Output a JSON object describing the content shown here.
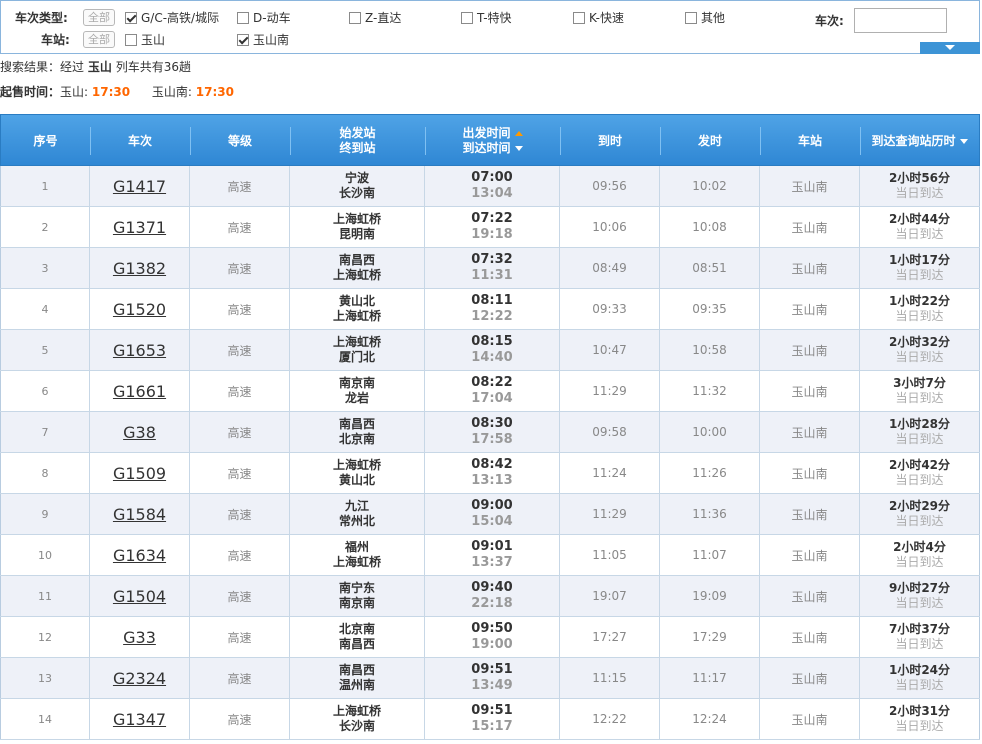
{
  "filters": {
    "type_label": "车次类型:",
    "all_label": "全部",
    "types": [
      {
        "label": "G/C-高铁/城际",
        "checked": true
      },
      {
        "label": "D-动车",
        "checked": false
      },
      {
        "label": "Z-直达",
        "checked": false
      },
      {
        "label": "T-特快",
        "checked": false
      },
      {
        "label": "K-快速",
        "checked": false
      },
      {
        "label": "其他",
        "checked": false
      }
    ],
    "station_label": "车站:",
    "stations": [
      {
        "label": "玉山",
        "checked": false
      },
      {
        "label": "玉山南",
        "checked": true
      }
    ],
    "train_no_label": "车次:",
    "train_no_value": ""
  },
  "summary": {
    "prefix": "搜索结果：经过",
    "station": "玉山",
    "suffix": "列车共有36趟",
    "sale_label": "起售时间：",
    "sale1_station": "玉山:",
    "sale1_time": "17:30",
    "sale2_station": "玉山南:",
    "sale2_time": "17:30"
  },
  "table": {
    "headers": {
      "idx": "序号",
      "train": "车次",
      "grade": "等级",
      "from": "始发站",
      "to": "终到站",
      "dep": "出发时间",
      "arr": "到达时间",
      "arrive": "到时",
      "depart": "发时",
      "station": "车站",
      "duration": "到达查询站历时"
    },
    "rows": [
      {
        "idx": "1",
        "train": "G1417",
        "grade": "高速",
        "from": "宁波",
        "to": "长沙南",
        "dep": "07:00",
        "arr": "13:04",
        "arrive": "09:56",
        "depart": "10:02",
        "station": "玉山南",
        "dur": "2小时56分",
        "same": "当日到达"
      },
      {
        "idx": "2",
        "train": "G1371",
        "grade": "高速",
        "from": "上海虹桥",
        "to": "昆明南",
        "dep": "07:22",
        "arr": "19:18",
        "arrive": "10:06",
        "depart": "10:08",
        "station": "玉山南",
        "dur": "2小时44分",
        "same": "当日到达"
      },
      {
        "idx": "3",
        "train": "G1382",
        "grade": "高速",
        "from": "南昌西",
        "to": "上海虹桥",
        "dep": "07:32",
        "arr": "11:31",
        "arrive": "08:49",
        "depart": "08:51",
        "station": "玉山南",
        "dur": "1小时17分",
        "same": "当日到达"
      },
      {
        "idx": "4",
        "train": "G1520",
        "grade": "高速",
        "from": "黄山北",
        "to": "上海虹桥",
        "dep": "08:11",
        "arr": "12:22",
        "arrive": "09:33",
        "depart": "09:35",
        "station": "玉山南",
        "dur": "1小时22分",
        "same": "当日到达"
      },
      {
        "idx": "5",
        "train": "G1653",
        "grade": "高速",
        "from": "上海虹桥",
        "to": "厦门北",
        "dep": "08:15",
        "arr": "14:40",
        "arrive": "10:47",
        "depart": "10:58",
        "station": "玉山南",
        "dur": "2小时32分",
        "same": "当日到达"
      },
      {
        "idx": "6",
        "train": "G1661",
        "grade": "高速",
        "from": "南京南",
        "to": "龙岩",
        "dep": "08:22",
        "arr": "17:04",
        "arrive": "11:29",
        "depart": "11:32",
        "station": "玉山南",
        "dur": "3小时7分",
        "same": "当日到达"
      },
      {
        "idx": "7",
        "train": "G38",
        "grade": "高速",
        "from": "南昌西",
        "to": "北京南",
        "dep": "08:30",
        "arr": "17:58",
        "arrive": "09:58",
        "depart": "10:00",
        "station": "玉山南",
        "dur": "1小时28分",
        "same": "当日到达"
      },
      {
        "idx": "8",
        "train": "G1509",
        "grade": "高速",
        "from": "上海虹桥",
        "to": "黄山北",
        "dep": "08:42",
        "arr": "13:13",
        "arrive": "11:24",
        "depart": "11:26",
        "station": "玉山南",
        "dur": "2小时42分",
        "same": "当日到达"
      },
      {
        "idx": "9",
        "train": "G1584",
        "grade": "高速",
        "from": "九江",
        "to": "常州北",
        "dep": "09:00",
        "arr": "15:04",
        "arrive": "11:29",
        "depart": "11:36",
        "station": "玉山南",
        "dur": "2小时29分",
        "same": "当日到达"
      },
      {
        "idx": "10",
        "train": "G1634",
        "grade": "高速",
        "from": "福州",
        "to": "上海虹桥",
        "dep": "09:01",
        "arr": "13:37",
        "arrive": "11:05",
        "depart": "11:07",
        "station": "玉山南",
        "dur": "2小时4分",
        "same": "当日到达"
      },
      {
        "idx": "11",
        "train": "G1504",
        "grade": "高速",
        "from": "南宁东",
        "to": "南京南",
        "dep": "09:40",
        "arr": "22:18",
        "arrive": "19:07",
        "depart": "19:09",
        "station": "玉山南",
        "dur": "9小时27分",
        "same": "当日到达"
      },
      {
        "idx": "12",
        "train": "G33",
        "grade": "高速",
        "from": "北京南",
        "to": "南昌西",
        "dep": "09:50",
        "arr": "19:00",
        "arrive": "17:27",
        "depart": "17:29",
        "station": "玉山南",
        "dur": "7小时37分",
        "same": "当日到达"
      },
      {
        "idx": "13",
        "train": "G2324",
        "grade": "高速",
        "from": "南昌西",
        "to": "温州南",
        "dep": "09:51",
        "arr": "13:49",
        "arrive": "11:15",
        "depart": "11:17",
        "station": "玉山南",
        "dur": "1小时24分",
        "same": "当日到达"
      },
      {
        "idx": "14",
        "train": "G1347",
        "grade": "高速",
        "from": "上海虹桥",
        "to": "长沙南",
        "dep": "09:51",
        "arr": "15:17",
        "arrive": "12:22",
        "depart": "12:24",
        "station": "玉山南",
        "dur": "2小时31分",
        "same": "当日到达"
      }
    ]
  },
  "colors": {
    "header_blue": "#2f87d4",
    "sale_time": "#ff6600",
    "row_alt": "#eef1f8"
  }
}
